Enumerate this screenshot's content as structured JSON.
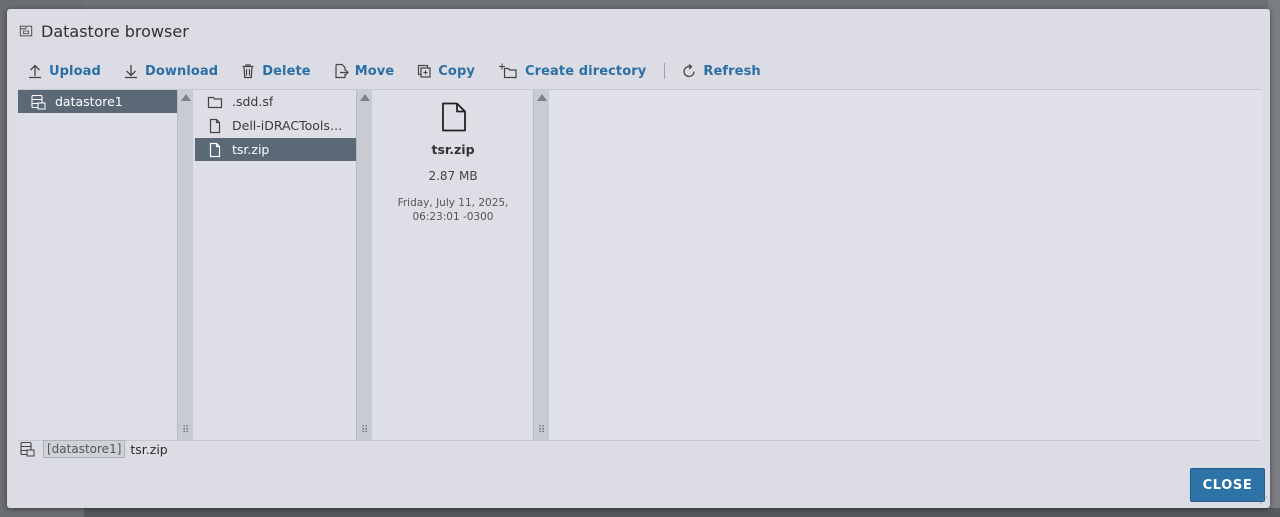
{
  "dialog": {
    "title": "Datastore browser"
  },
  "toolbar": {
    "upload": "Upload",
    "download": "Download",
    "delete": "Delete",
    "move": "Move",
    "copy": "Copy",
    "create_directory": "Create directory",
    "refresh": "Refresh"
  },
  "datastores": [
    {
      "name": "datastore1",
      "selected": true
    }
  ],
  "files": [
    {
      "name": ".sdd.sf",
      "type": "folder",
      "selected": false
    },
    {
      "name": "Dell-iDRACTools-...",
      "type": "file",
      "selected": false
    },
    {
      "name": "tsr.zip",
      "type": "file",
      "selected": true
    }
  ],
  "preview": {
    "name": "tsr.zip",
    "size": "2.87 MB",
    "date_line1": "Friday, July 11, 2025,",
    "date_line2": "06:23:01 -0300"
  },
  "path": {
    "datastore": "[datastore1]",
    "file": "tsr.zip"
  },
  "footer": {
    "close_label": "CLOSE"
  },
  "colors": {
    "accent": "#2e73a8",
    "selection": "#5a6975",
    "link": "#2b6fa6"
  }
}
